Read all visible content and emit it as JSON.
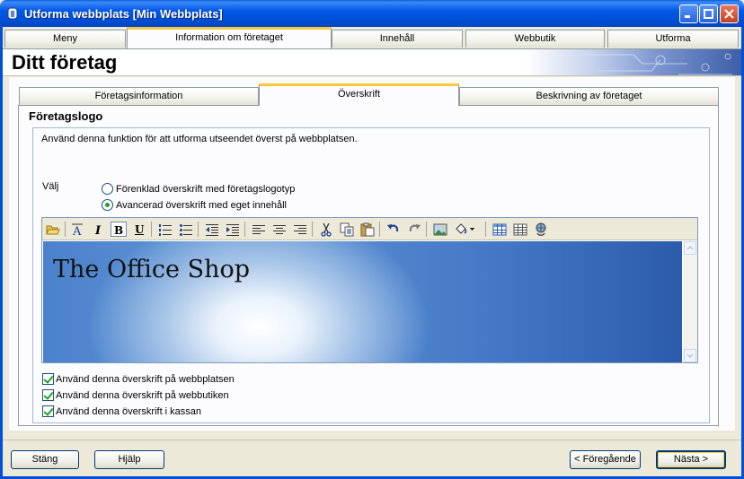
{
  "window": {
    "title": "Utforma webbplats [Min Webbplats]"
  },
  "main_tabs": [
    {
      "label": "Meny"
    },
    {
      "label": "Information om företaget"
    },
    {
      "label": "Innehåll"
    },
    {
      "label": "Webbutik"
    },
    {
      "label": "Utforma"
    }
  ],
  "header": {
    "title": "Ditt företag"
  },
  "sub_tabs": [
    {
      "label": "Företagsinformation"
    },
    {
      "label": "Överskrift"
    },
    {
      "label": "Beskrivning av företaget"
    }
  ],
  "section": {
    "title": "Företagslogo",
    "description": "Använd denna funktion för att utforma utseendet överst på webbplatsen.",
    "choose_label": "Välj",
    "radio_simple": "Förenklad överskrift med företagslogotyp",
    "radio_advanced": "Avancerad överskrift med eget innehåll"
  },
  "editor": {
    "banner_text": "The Office Shop"
  },
  "checks": [
    {
      "label": "Använd denna överskrift på webbplatsen",
      "checked": true
    },
    {
      "label": "Använd denna överskrift på webbutiken",
      "checked": true
    },
    {
      "label": "Använd denna överskrift i kassan",
      "checked": true
    }
  ],
  "buttons": {
    "close": "Stäng",
    "help": "Hjälp",
    "previous": "< Föregående",
    "next": "Nästa >"
  }
}
